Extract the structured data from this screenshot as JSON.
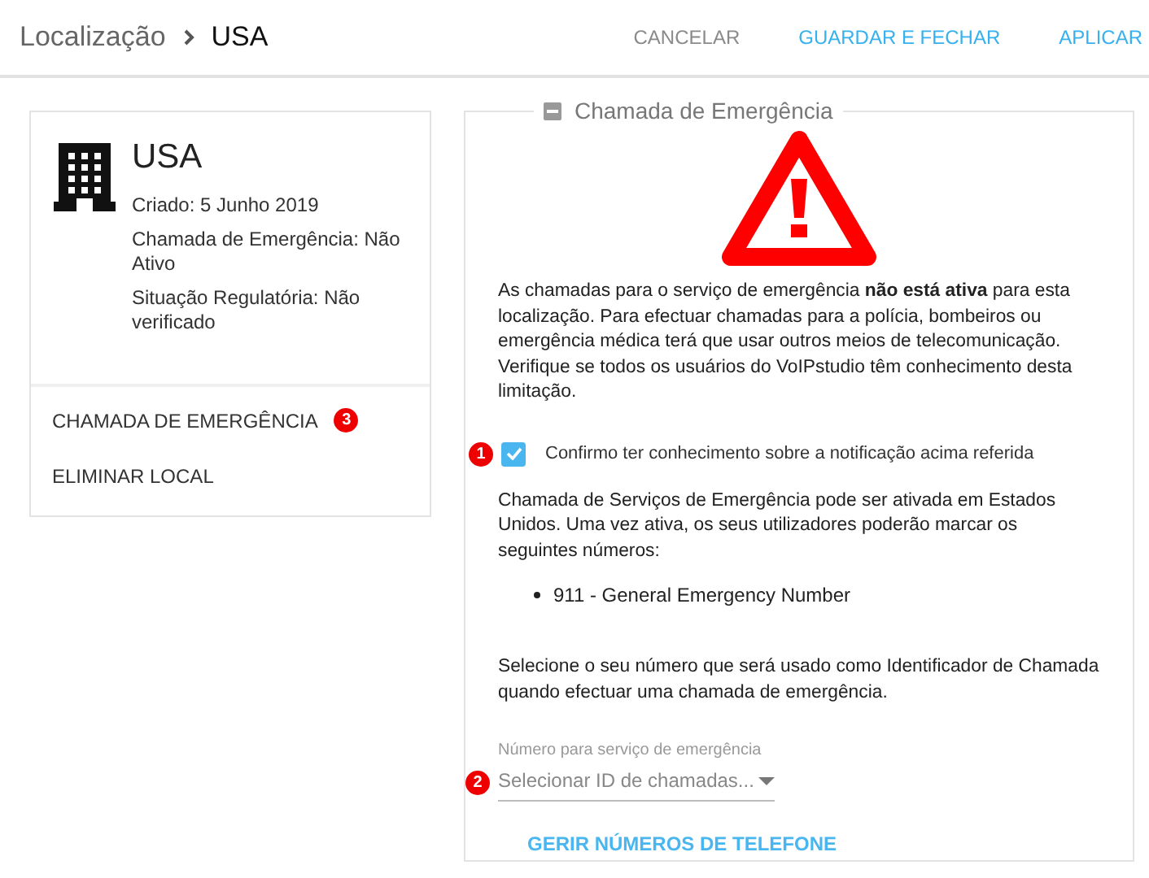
{
  "header": {
    "breadcrumb": "Localização",
    "current": "USA",
    "actions": [
      {
        "label": "CANCELAR",
        "kind": "muted"
      },
      {
        "label": "GUARDAR E FECHAR",
        "kind": "primary"
      },
      {
        "label": "APLICAR",
        "kind": "primary"
      }
    ]
  },
  "location": {
    "name": "USA",
    "details": [
      "Criado: 5 Junho 2019",
      "Chamada de Emergência: Não Ativo",
      "Situação Regulatória: Não verificado"
    ],
    "menu": [
      {
        "label": "CHAMADA DE EMERGÊNCIA",
        "badge": "3"
      },
      {
        "label": "ELIMINAR LOCAL"
      }
    ]
  },
  "panel": {
    "title": "Chamada de Emergência",
    "warning": "As chamadas para o serviço de emergência **não está ativa** para esta localização. Para efectuar chamadas para a polícia, bombeiros ou emergência médica terá que usar outros meios de telecomunicação. Verifique se todos os usuários do VoIPstudio têm conhecimento desta limitação.",
    "confirm": {
      "label": "Confirmo ter conhecimento sobre a notificação acima referida",
      "checked": true,
      "badge": "1"
    },
    "info": "Chamada de Serviços de Emergência pode ser ativada em Estados Unidos. Uma vez ativa, os seus utilizadores poderão marcar os seguintes números:",
    "numbers": [
      "911 - General Emergency Number"
    ],
    "select_info": "Selecione o seu número que será usado como Identificador de Chamada quando efectuar uma chamada de emergência.",
    "field": {
      "label": "Número para serviço de emergência",
      "placeholder": "Selecionar ID de chamadas...",
      "badge": "2"
    },
    "link": "GERIR NÚMEROS DE TELEFONE"
  }
}
